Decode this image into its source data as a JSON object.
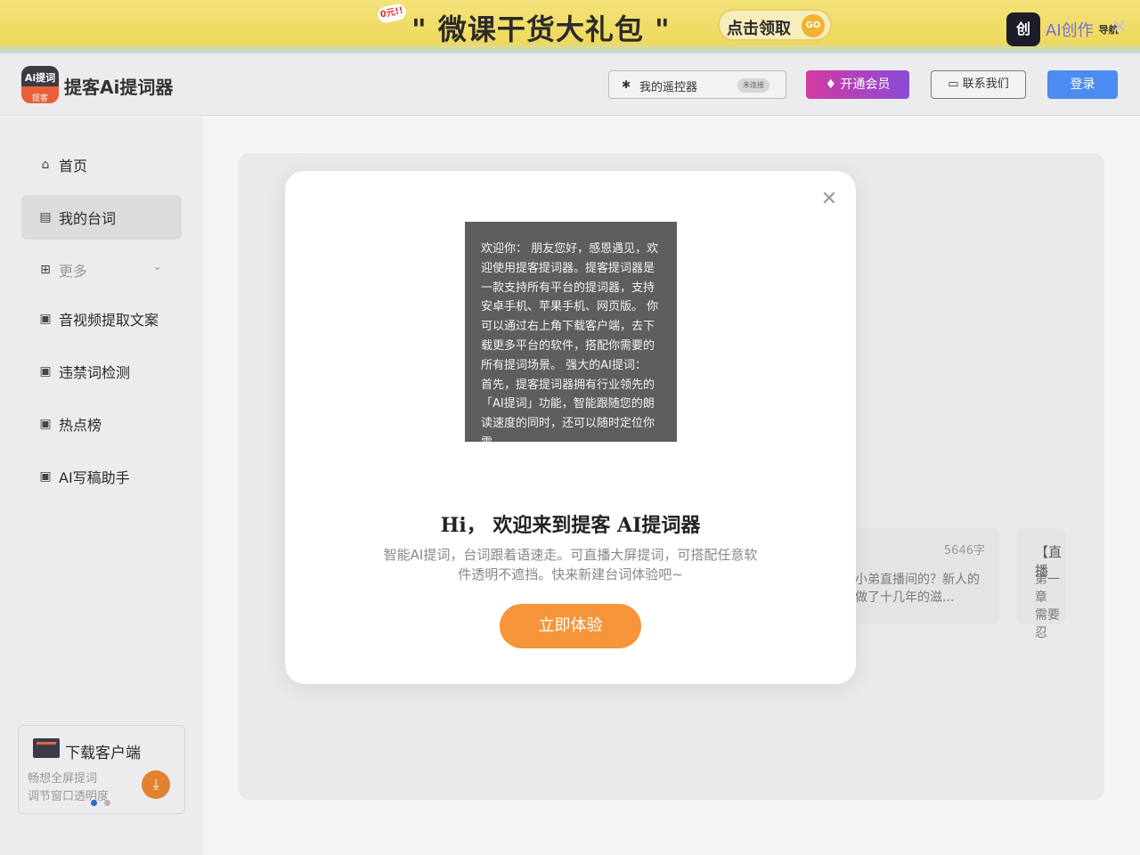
{
  "banner": {
    "free_tag": "0元!!",
    "title": "\" 微课干货大礼包 \"",
    "cta_label": "点击领取",
    "cta_go": "GO",
    "brand_icon": "创",
    "brand_text": "AI创作",
    "brand_sub": "导航"
  },
  "header": {
    "logo_line1": "Ai提词",
    "logo_line2": "提客",
    "brand_name": "提客Ai提词器",
    "remote_label": "我的遥控器",
    "remote_status": "未连接",
    "vip_label": "开通会员",
    "contact_label": "联系我们",
    "login_label": "登录"
  },
  "sidebar": {
    "items": [
      {
        "label": "首页"
      },
      {
        "label": "我的台词"
      },
      {
        "label": "更多"
      },
      {
        "label": "音视频提取文案"
      },
      {
        "label": "违禁词检测"
      },
      {
        "label": "热点榜"
      },
      {
        "label": "AI写稿助手"
      }
    ],
    "download": {
      "title": "下载客户端",
      "line1": "畅想全屏提词",
      "line2": "调节窗口透明度"
    }
  },
  "cards": [
    {
      "count": "5646字",
      "text1": "小弟直播间的？新人的",
      "text2": "做了十几年的滋..."
    },
    {
      "head": "【直播",
      "text1": "第一章",
      "text2": "需要忍"
    }
  ],
  "modal": {
    "preview_text": "欢迎你： 朋友您好，感恩遇见，欢迎使用提客提词器。提客提词器是一款支持所有平台的提词器，支持安卓手机、苹果手机、网页版。 你可以通过右上角下载客户端，去下载更多平台的软件，搭配你需要的所有提词场景。 强大的AI提词： 首先，提客提词器拥有行业领先的「AI提词」功能，智能跟随您的朗读速度的同时，还可以随时定位你需",
    "title": "Hi， 欢迎来到提客 AI提词器",
    "description": "智能AI提词，台词跟着语速走。可直播大屏提词，可搭配任意软件透明不遮挡。快来新建台词体验吧~",
    "cta_label": "立即体验"
  }
}
